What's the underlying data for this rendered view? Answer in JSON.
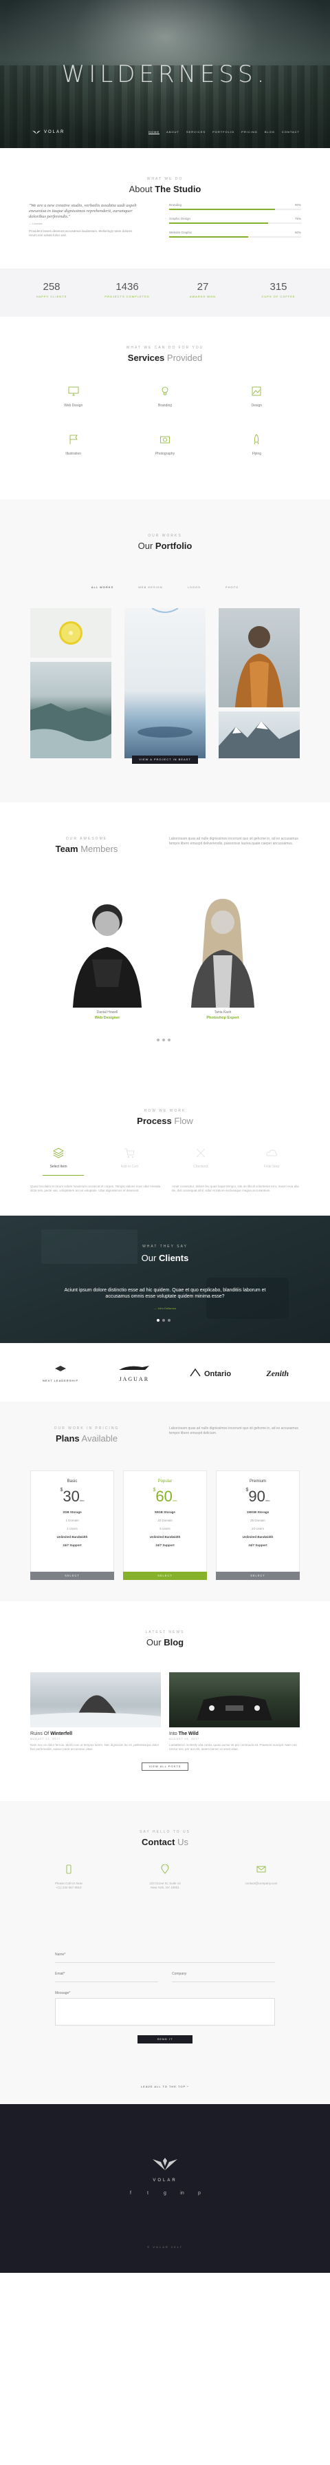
{
  "hero": {
    "title": "WILDERNESS.",
    "logo": "VOLAR",
    "nav": [
      "HOME",
      "ABOUT",
      "SERVICES",
      "PORTFOLIO",
      "PRICING",
      "BLOG",
      "CONTACT"
    ],
    "active_nav": "HOME"
  },
  "about": {
    "eyebrow": "WHAT WE DO",
    "title_pre": "About",
    "title_bold": "The Studio",
    "quote": "\"We are a new creative studio, verbatlis assabita uadi aspeh eneseoisa in itaque dignissimos reprehenderit, earumquer doloribus perferendis.\"",
    "quote_by": "— Leandar",
    "desc": "Provident lasses deserunt accusamus laudantium. Molloringit natos dolores rerum non soluta fulico usit.",
    "skills": [
      {
        "name": "Branding",
        "value": "80%",
        "pct": 80
      },
      {
        "name": "Graphic Design",
        "value": "75%",
        "pct": 75
      },
      {
        "name": "Website Graphic",
        "value": "60%",
        "pct": 60
      }
    ]
  },
  "stats": [
    {
      "num": "258",
      "label": "HAPPY CLIENTS"
    },
    {
      "num": "1436",
      "label": "PROJECTS COMPLETED"
    },
    {
      "num": "27",
      "label": "AWARDS WON"
    },
    {
      "num": "315",
      "label": "CUPS OF COFFEE"
    }
  ],
  "services": {
    "eyebrow": "WHAT WE CAN DO FOR YOU",
    "title_pre": "Services",
    "title_light": "Provided",
    "items": [
      {
        "name": "Web Design",
        "icon": "monitor-icon"
      },
      {
        "name": "Branding",
        "icon": "bulb-icon"
      },
      {
        "name": "Design",
        "icon": "image-icon"
      },
      {
        "name": "Illustration",
        "icon": "flag-icon"
      },
      {
        "name": "Photography",
        "icon": "camera-icon"
      },
      {
        "name": "Flying",
        "icon": "rocket-icon"
      }
    ]
  },
  "portfolio": {
    "eyebrow": "OUR WORKS",
    "title_pre": "Our",
    "title_bold": "Portfolio",
    "filters": [
      "ALL WORKS",
      "WEB DESIGN",
      "LOGOS",
      "PHOTO"
    ],
    "active_filter": "ALL WORKS",
    "button": "VIEW A PROJECT IN BEAST"
  },
  "team": {
    "eyebrow": "OUR AWESOME",
    "title_pre": "Team",
    "title_light": "Members",
    "desc": "Laboriosam quas ad nulle dignissimos incorrunt quo sit gehcme in, ad ex accusamus tempor libero emuspit deliveriendis, passonissi laurea quate caeper ancussamus.",
    "members": [
      {
        "name": "Danial Howell",
        "role": "Web Designer"
      },
      {
        "name": "Tania Kash",
        "role": "Photoshop Expert"
      }
    ]
  },
  "process": {
    "eyebrow": "HOW WE WORK",
    "title_pre": "Process",
    "title_light": "Flow",
    "steps": [
      "Select Item",
      "Add to Cart",
      "Checkout",
      "Final Step"
    ],
    "text_left": "Quasi recolaim et rerum volum maximum occaecat et corpes. Tempis ratione irure ultur enesda dicta nes, pecte vas, voluptatem accus voluptate. Ultur dignissimos et deserunt.",
    "text_right": "Amet consecitur, dolore feu quae loque tempor, iste de illiculi volunteriet erro, maiori ecia alia de, duli consequat nihil, vidar et labore exclusaque magna accusantium."
  },
  "clients": {
    "eyebrow": "WHAT THEY SAY",
    "title_pre": "Our",
    "title_bold": "Clients",
    "quote": "Aciunt ipsum dolore distinctio esse ad hic quidem. Quae et quo explicabo, blanditiis laborum et accusamus omnis esse voluptate quidem minima esse?",
    "author": "— John Dellarosa"
  },
  "logos": [
    "NEXT LEADERSHIP",
    "JAGUAR",
    "Ontario",
    "Zenith"
  ],
  "pricing": {
    "eyebrow": "OUR WORK IN PRICING",
    "title_pre": "Plans",
    "title_light": "Available",
    "desc": "Laboriosam quas ad nulle dignissimos incorrunt quo sit gehcme in, ad ex accusamus tempor libero emuspit delicium.",
    "plans": [
      {
        "name": "Basic",
        "price": "30",
        "features": [
          "2GB Storage",
          "1 Domain",
          "1 Users",
          "Unlimited Bandwidth",
          "24/7 Support"
        ],
        "select": "SELECT"
      },
      {
        "name": "Popular",
        "price": "60",
        "features": [
          "50GB Storage",
          "10 Domain",
          "5 Users",
          "Unlimited Bandwidth",
          "24/7 Support"
        ],
        "select": "SELECT"
      },
      {
        "name": "Premium",
        "price": "90",
        "features": [
          "150GB Storage",
          "25 Domain",
          "10 Users",
          "Unlimited Bandwidth",
          "24/7 Support"
        ],
        "select": "SELECT"
      }
    ],
    "currency": "$",
    "period": "/mo"
  },
  "blog": {
    "eyebrow": "LATEST NEWS",
    "title_pre": "Our",
    "title_bold": "Blog",
    "posts": [
      {
        "title_pre": "Ruins Of",
        "title_bold": "Winterfell",
        "meta": "AUGUST 12, 2017",
        "text": "Nam nec ex dolor ferruis. Morbi non ut tempus lorem. Nec dignissim leo et, pellentesque dolor faci perferendis, auteur paret accumsan vitae."
      },
      {
        "title_pre": "Into",
        "title_bold": "The Wild",
        "meta": "AUGUST 09, 2017",
        "text": "Lantatbrinci molestly vita corda, quasi auctur sit per commodo sit. Praesent suscipit. Nam nec nectur nisi, per aut elit, autem tamen ut amet vitae."
      }
    ],
    "button": "VIEW ALL POSTS"
  },
  "contact": {
    "eyebrow": "SAY HELLO TO US",
    "title_pre": "Contact",
    "title_light": "Us",
    "items": [
      {
        "icon": "phone-icon",
        "text": "Please Call Us Now\n+(1) 234 567 8910"
      },
      {
        "icon": "pin-icon",
        "text": "123 Grove St, Suite 14\nNew York, NY 10001"
      },
      {
        "icon": "mail-icon",
        "text": "contact@company.com"
      }
    ],
    "labels": {
      "name": "Name*",
      "email": "Email*",
      "company": "Company",
      "message": "Message*"
    },
    "send": "SEND IT",
    "back_top": "LEAVE ALL TO THE TOP ^"
  },
  "footer": {
    "logo": "VOLAR",
    "socials": [
      "f",
      "t",
      "g",
      "in",
      "p"
    ],
    "bottom": "© VOLAR 2017"
  }
}
